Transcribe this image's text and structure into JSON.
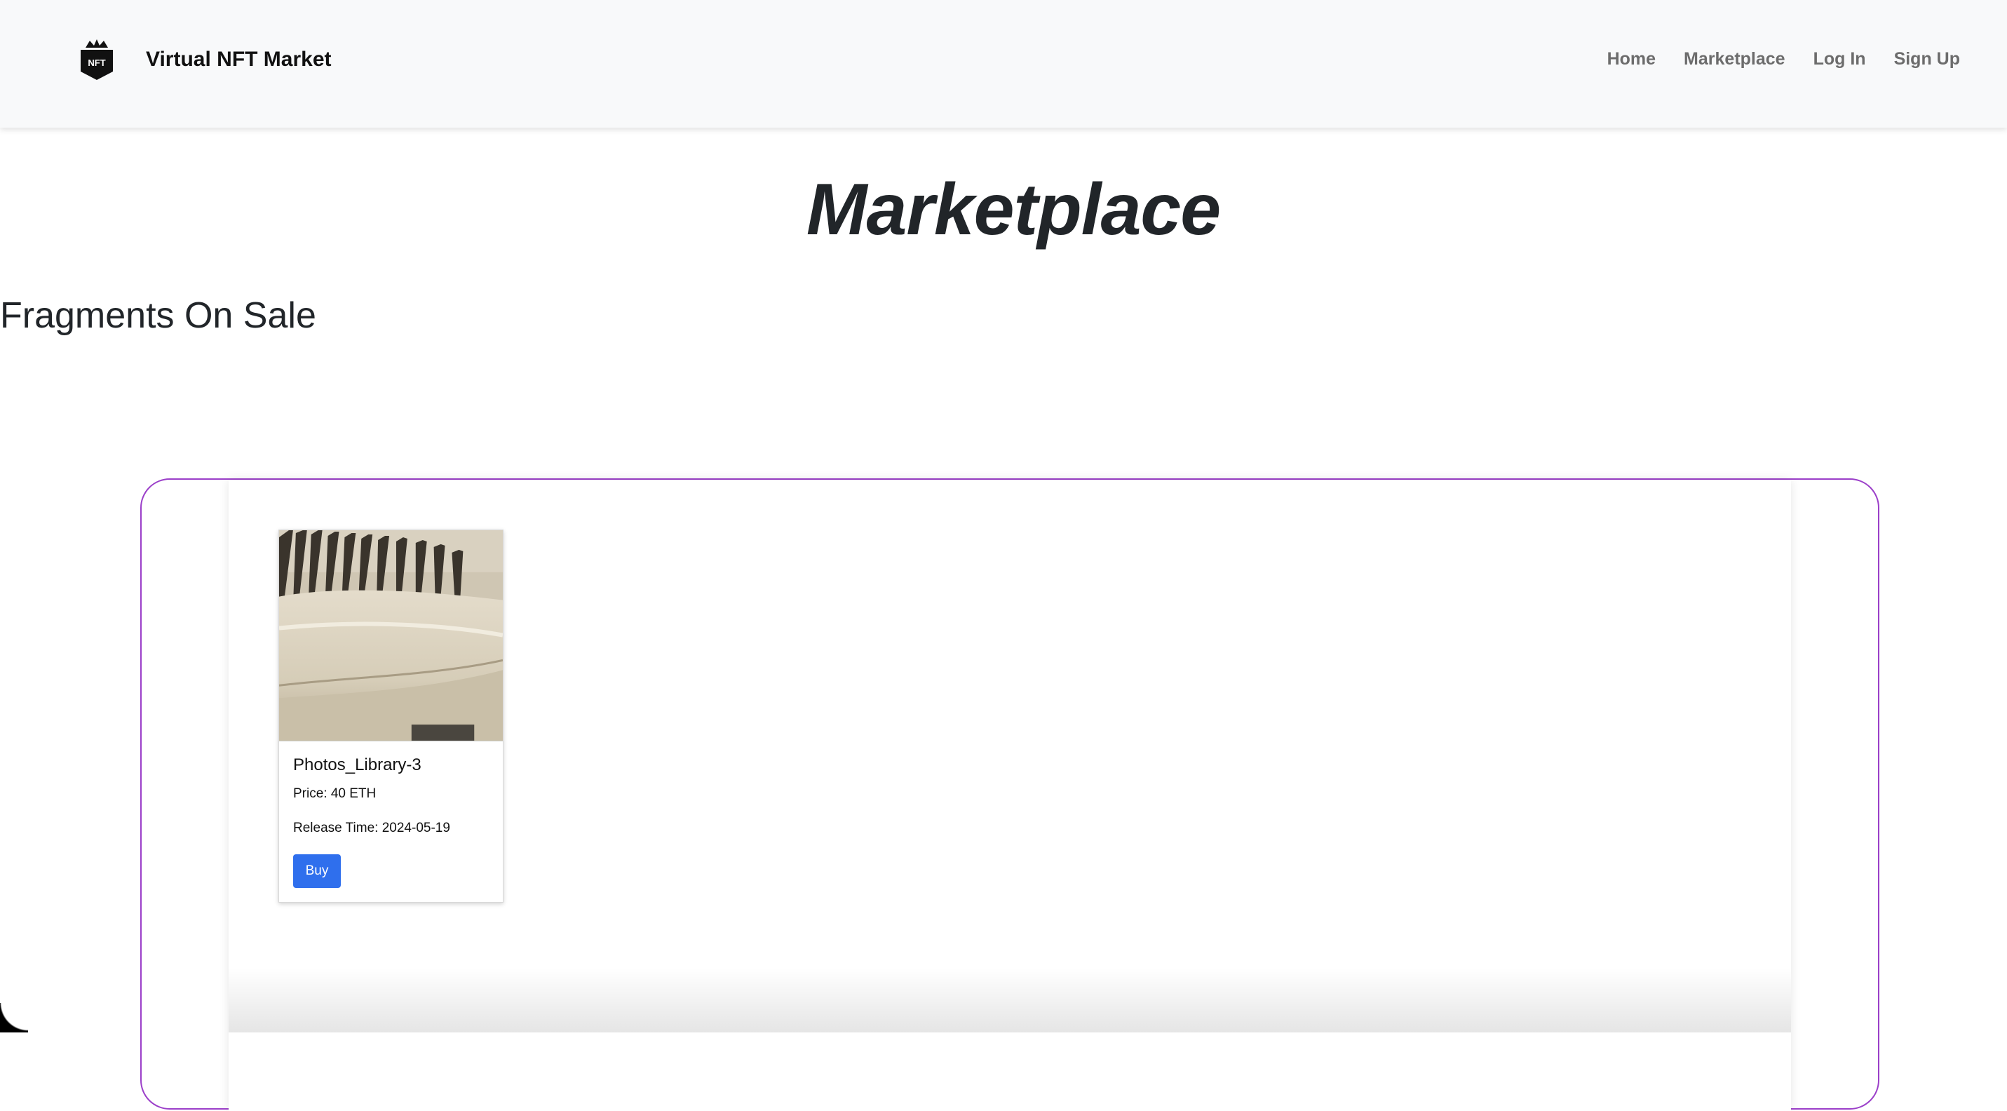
{
  "header": {
    "brand_name": "Virtual NFT Market",
    "logo_text": "NFT",
    "nav": {
      "home": "Home",
      "marketplace": "Marketplace",
      "login": "Log In",
      "signup": "Sign Up"
    }
  },
  "main": {
    "title": "Marketplace",
    "section_heading": "Fragments On Sale"
  },
  "items": [
    {
      "name": "Photos_Library-3",
      "price": "Price: 40 ETH",
      "release": "Release Time: 2024-05-19",
      "buy_label": "Buy"
    }
  ],
  "colors": {
    "accent_button": "#2f6fed",
    "frame_border": "#9b3fc9",
    "navbar_bg": "#f8f9fa"
  }
}
